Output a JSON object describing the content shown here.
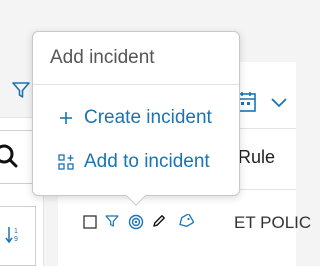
{
  "popup": {
    "title": "Add incident",
    "items": [
      {
        "label": "Create incident",
        "icon": "plus-icon"
      },
      {
        "label": "Add to incident",
        "icon": "add-to-incident-icon"
      }
    ]
  },
  "table": {
    "column_header": "Rule",
    "row_text": "ET POLIC"
  },
  "colors": {
    "accent": "#1a73b5",
    "popup_border": "#c8c8c8"
  }
}
